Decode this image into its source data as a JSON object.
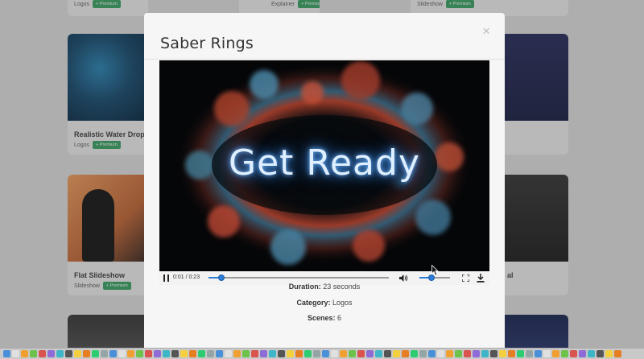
{
  "modal": {
    "title": "Saber Rings",
    "close_symbol": "×",
    "video_text": "Get Ready",
    "player": {
      "time": "0:01 / 0:23",
      "progress_fraction": 0.07,
      "volume_fraction": 0.4
    },
    "info": {
      "duration_label": "Duration:",
      "duration_value": "23 seconds",
      "category_label": "Category:",
      "category_value": "Logos",
      "scenes_label": "Scenes:",
      "scenes_value": "6"
    }
  },
  "gallery": {
    "badge_label": "+ Premium",
    "row0": [
      {
        "meta": "Logos"
      },
      {
        "meta": "Explainer"
      },
      {
        "meta": "Slideshow"
      }
    ],
    "cards": [
      {
        "title": "Realistic Water Drop",
        "meta": "Logos"
      },
      {
        "title": "Flat Slideshow",
        "meta": "Slideshow"
      }
    ],
    "right_partial_text": "al"
  },
  "icons": [
    "pause-icon",
    "volume-icon",
    "fullscreen-icon",
    "download-icon",
    "close-icon",
    "mouse-cursor-icon"
  ],
  "colors": {
    "accent": "#2e7bd6",
    "premium_badge": "#3fa768",
    "glow": "#6fb7ff"
  }
}
